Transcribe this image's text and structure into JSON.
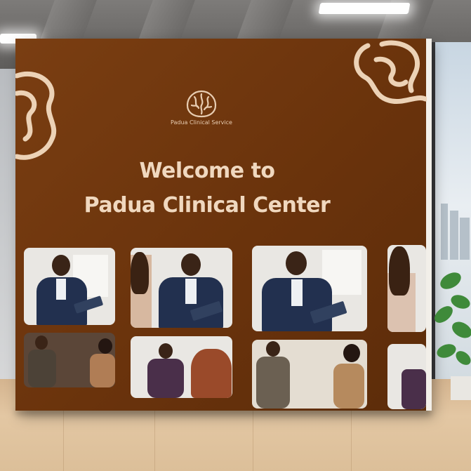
{
  "scene": {
    "brand_name": "Padua Clinical Service",
    "headline_line1": "Welcome to",
    "headline_line2": "Padua Clinical Center",
    "panel_color": "#6e350e",
    "text_color": "#f0d8bf",
    "photos_top": [
      "doctor-with-clipboard",
      "doctor-with-clipboard-smiling",
      "doctor-with-clipboard",
      "patient-partial"
    ],
    "photos_bottom": [
      "therapy-session",
      "doctor-and-patient",
      "therapy-session",
      "patient-partial"
    ]
  }
}
